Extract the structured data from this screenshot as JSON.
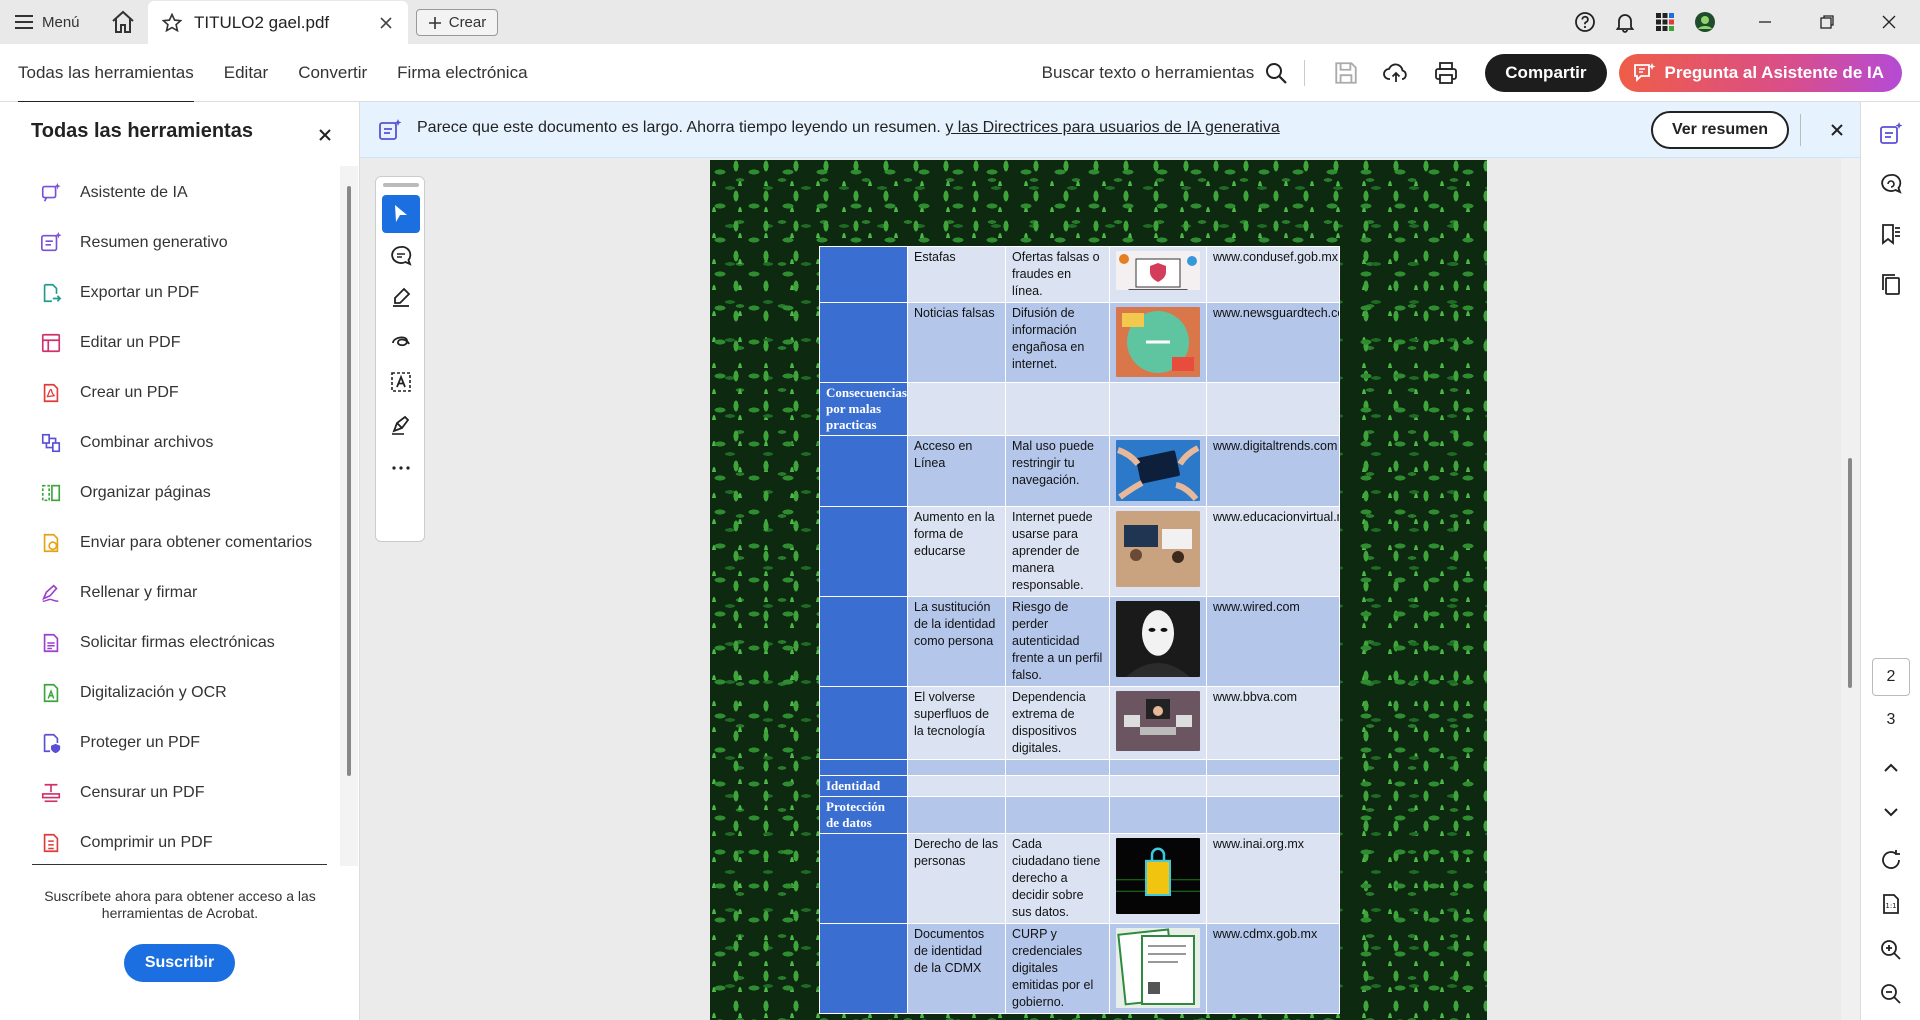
{
  "titlebar": {
    "menu_label": "Menú",
    "tab_title": "TITULO2 gael.pdf",
    "create_label": "Crear"
  },
  "toolbar": {
    "nav": [
      "Todas las herramientas",
      "Editar",
      "Convertir",
      "Firma electrónica"
    ],
    "search_label": "Buscar texto o herramientas",
    "share_label": "Compartir",
    "ai_label": "Pregunta al Asistente de IA"
  },
  "sidebar": {
    "title": "Todas las herramientas",
    "items": [
      {
        "label": "Asistente de IA",
        "icon": "ai-assistant-icon",
        "color": "#7b4fd6"
      },
      {
        "label": "Resumen generativo",
        "icon": "summary-icon",
        "color": "#7b4fd6"
      },
      {
        "label": "Exportar un PDF",
        "icon": "export-pdf-icon",
        "color": "#1f9d8c"
      },
      {
        "label": "Editar un PDF",
        "icon": "edit-pdf-icon",
        "color": "#d0306b"
      },
      {
        "label": "Crear un PDF",
        "icon": "create-pdf-icon",
        "color": "#e03b3b"
      },
      {
        "label": "Combinar archivos",
        "icon": "combine-icon",
        "color": "#5a4fd6"
      },
      {
        "label": "Organizar páginas",
        "icon": "organize-icon",
        "color": "#3aa63a"
      },
      {
        "label": "Enviar para obtener comentarios",
        "icon": "send-comments-icon",
        "color": "#e3a313"
      },
      {
        "label": "Rellenar y firmar",
        "icon": "fill-sign-icon",
        "color": "#9b3fd0"
      },
      {
        "label": "Solicitar firmas electrónicas",
        "icon": "request-sign-icon",
        "color": "#9b3fd0"
      },
      {
        "label": "Digitalización y OCR",
        "icon": "scan-ocr-icon",
        "color": "#3aa63a"
      },
      {
        "label": "Proteger un PDF",
        "icon": "protect-icon",
        "color": "#5a4fd6"
      },
      {
        "label": "Censurar un PDF",
        "icon": "redact-icon",
        "color": "#d0306b"
      },
      {
        "label": "Comprimir un PDF",
        "icon": "compress-icon",
        "color": "#e03b3b"
      }
    ],
    "subscribe_text": "Suscríbete ahora para obtener acceso a las herramientas de Acrobat.",
    "subscribe_button": "Suscribir"
  },
  "banner": {
    "text": "Parece que este documento es largo. Ahorra tiempo leyendo un resumen.",
    "link": "y las Directrices para usuarios de IA generativa",
    "button": "Ver resumen"
  },
  "document": {
    "rows": [
      {
        "c1": "",
        "c2": "Estafas",
        "c3": "Ofertas falsas o fraudes en línea.",
        "img": "laptop-security-icon",
        "c5": "www.condusef.gob.mx",
        "shade": "lt",
        "h": 49
      },
      {
        "c1": "",
        "c2": "Noticias falsas",
        "c3": "Difusión de información engañosa en internet.",
        "img": "fake-news-icon",
        "c5": "www.newsguardtech.com",
        "shade": "alt",
        "h": 80
      },
      {
        "c1": "Consecuencias por malas practicas",
        "c2": "",
        "c3": "",
        "img": "",
        "c5": "",
        "shade": "lt",
        "h": 50
      },
      {
        "c1": "",
        "c2": "Acceso en Línea",
        "c3": "Mal uso puede restringir tu navegación.",
        "img": "hands-tablet-icon",
        "c5": "www.digitaltrends.com",
        "shade": "alt",
        "h": 71
      },
      {
        "c1": "",
        "c2": "Aumento en la forma de educarse",
        "c3": "Internet puede usarse para aprender de manera responsable.",
        "img": "classroom-icon",
        "c5": "www.educacionvirtual.mx",
        "shade": "lt",
        "h": 86
      },
      {
        "c1": "",
        "c2": "La sustitución de la identidad como persona",
        "c3": "Riesgo de perder autenticidad frente a un perfil falso.",
        "img": "mask-icon",
        "c5": "www.wired.com",
        "shade": "alt",
        "h": 86
      },
      {
        "c1": "",
        "c2": "El volverse superfluos de la tecnología",
        "c3": "Dependencia extrema de dispositivos digitales.",
        "img": "devices-icon",
        "c5": "www.bbva.com",
        "shade": "lt",
        "h": 70
      },
      {
        "c1": "",
        "c2": "",
        "c3": "",
        "img": "",
        "c5": "",
        "shade": "alt",
        "h": 16
      },
      {
        "c1": "Identidad",
        "c2": "",
        "c3": "",
        "img": "",
        "c5": "",
        "shade": "lt",
        "h": 20
      },
      {
        "c1": "Protección de datos",
        "c2": "",
        "c3": "",
        "img": "",
        "c5": "",
        "shade": "alt",
        "h": 36
      },
      {
        "c1": "",
        "c2": "Derecho de las personas",
        "c3": "Cada ciudadano tiene derecho a decidir sobre sus datos.",
        "img": "data-lock-icon",
        "c5": "www.inai.org.mx",
        "shade": "lt",
        "h": 86
      },
      {
        "c1": "",
        "c2": "Documentos de identidad de la CDMX",
        "c3": "CURP y credenciales digitales emitidas por el gobierno.",
        "img": "documents-icon",
        "c5": "www.cdmx.gob.mx",
        "shade": "alt",
        "h": 90
      }
    ]
  },
  "rightrail": {
    "current_page": "2",
    "next_page": "3"
  },
  "colors": {
    "accent": "#1b6fe0",
    "table_header": "#3a6fd1",
    "table_row_dark": "#b4c6ea",
    "table_row_light": "#dbe3f3"
  }
}
